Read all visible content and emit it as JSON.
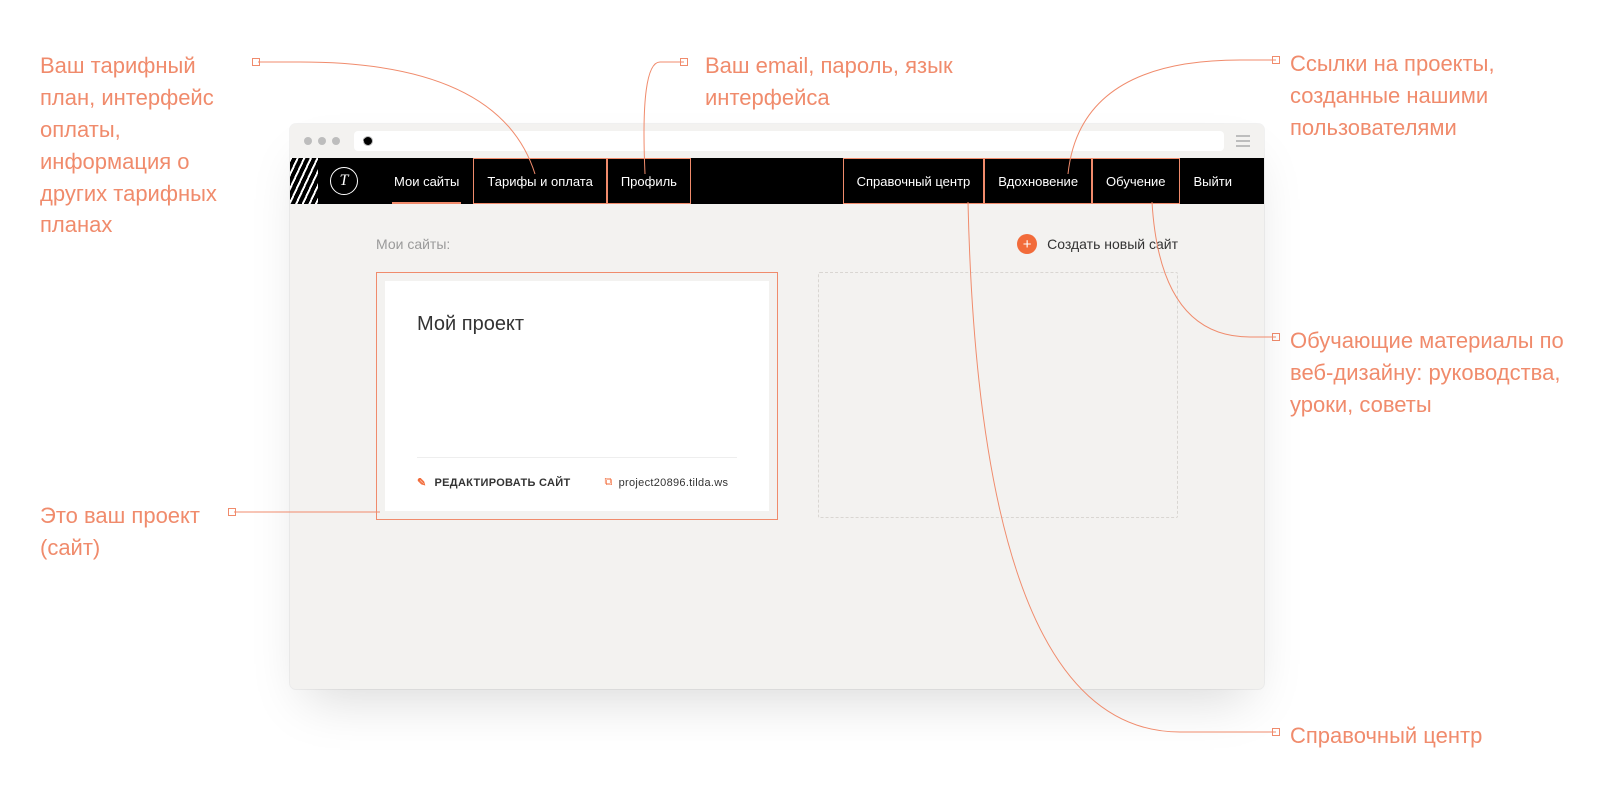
{
  "annotations": {
    "tariff": "Ваш тарифный план, интерфейс оплаты, информация о других тарифных планах",
    "profile": "Ваш email, пароль, язык интерфейса",
    "inspire": "Ссылки на проекты, созданные нашими пользователями",
    "learn": "Обучающие материалы по веб-дизайну: руководства, уроки, советы",
    "help": "Справочный центр",
    "project": "Это ваш проект (сайт)"
  },
  "nav": {
    "left": [
      {
        "label": "Мои сайты",
        "active": true,
        "highlight": false
      },
      {
        "label": "Тарифы и оплата",
        "active": false,
        "highlight": true
      },
      {
        "label": "Профиль",
        "active": false,
        "highlight": true
      }
    ],
    "right": [
      {
        "label": "Справочный центр",
        "highlight": true
      },
      {
        "label": "Вдохновение",
        "highlight": true
      },
      {
        "label": "Обучение",
        "highlight": true
      },
      {
        "label": "Выйти",
        "highlight": false
      }
    ]
  },
  "content": {
    "section_title": "Мои сайты:",
    "create_label": "Создать новый сайт",
    "card": {
      "title": "Мой проект",
      "edit_label": "РЕДАКТИРОВАТЬ САЙТ",
      "url": "project20896.tilda.ws"
    }
  },
  "logo_glyph": "T"
}
